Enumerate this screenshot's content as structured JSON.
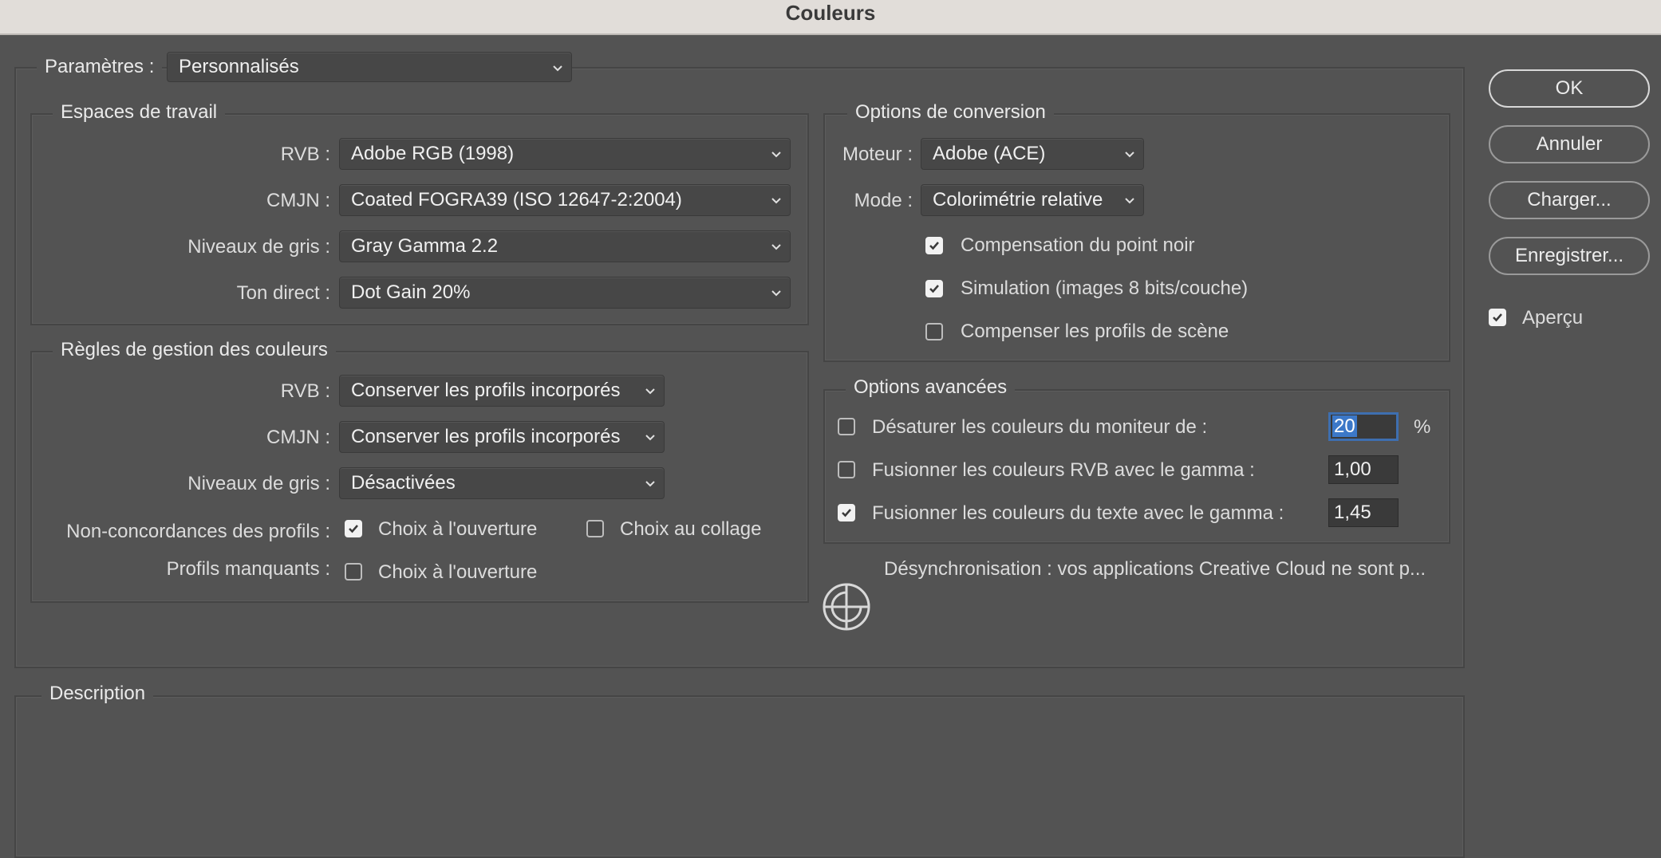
{
  "window": {
    "title": "Couleurs"
  },
  "settings": {
    "label": "Paramètres :",
    "value": "Personnalisés"
  },
  "working_spaces": {
    "legend": "Espaces de travail",
    "rvb_label": "RVB :",
    "rvb_value": "Adobe RGB (1998)",
    "cmjn_label": "CMJN :",
    "cmjn_value": "Coated FOGRA39 (ISO 12647-2:2004)",
    "gray_label": "Niveaux de gris :",
    "gray_value": "Gray Gamma 2.2",
    "spot_label": "Ton direct :",
    "spot_value": "Dot Gain 20%"
  },
  "policies": {
    "legend": "Règles de gestion des couleurs",
    "rvb_label": "RVB :",
    "rvb_value": "Conserver les profils incorporés",
    "cmjn_label": "CMJN :",
    "cmjn_value": "Conserver les profils incorporés",
    "gray_label": "Niveaux de gris :",
    "gray_value": "Désactivées",
    "mismatch_label": "Non-concordances des profils :",
    "mismatch_open": {
      "label": "Choix à l'ouverture",
      "checked": true
    },
    "mismatch_paste": {
      "label": "Choix au collage",
      "checked": false
    },
    "missing_label": "Profils manquants :",
    "missing_open": {
      "label": "Choix à l'ouverture",
      "checked": false
    }
  },
  "conversion": {
    "legend": "Options de conversion",
    "engine_label": "Moteur :",
    "engine_value": "Adobe (ACE)",
    "mode_label": "Mode :",
    "mode_value": "Colorimétrie relative",
    "black_point": {
      "label": "Compensation du point noir",
      "checked": true
    },
    "dither": {
      "label": "Simulation (images 8 bits/couche)",
      "checked": true
    },
    "scene": {
      "label": "Compenser les profils de scène",
      "checked": false
    }
  },
  "advanced": {
    "legend": "Options avancées",
    "desaturate": {
      "label": "Désaturer les couleurs du moniteur de :",
      "checked": false,
      "value": "20",
      "unit": "%"
    },
    "blend_rgb": {
      "label": "Fusionner les couleurs RVB avec le gamma :",
      "checked": false,
      "value": "1,00"
    },
    "blend_text": {
      "label": "Fusionner les couleurs du texte avec le gamma :",
      "checked": true,
      "value": "1,45"
    }
  },
  "sync_status": "Désynchronisation : vos applications Creative Cloud ne sont p...",
  "description": {
    "legend": "Description"
  },
  "buttons": {
    "ok": "OK",
    "cancel": "Annuler",
    "load": "Charger...",
    "save": "Enregistrer..."
  },
  "preview": {
    "label": "Aperçu",
    "checked": true
  }
}
